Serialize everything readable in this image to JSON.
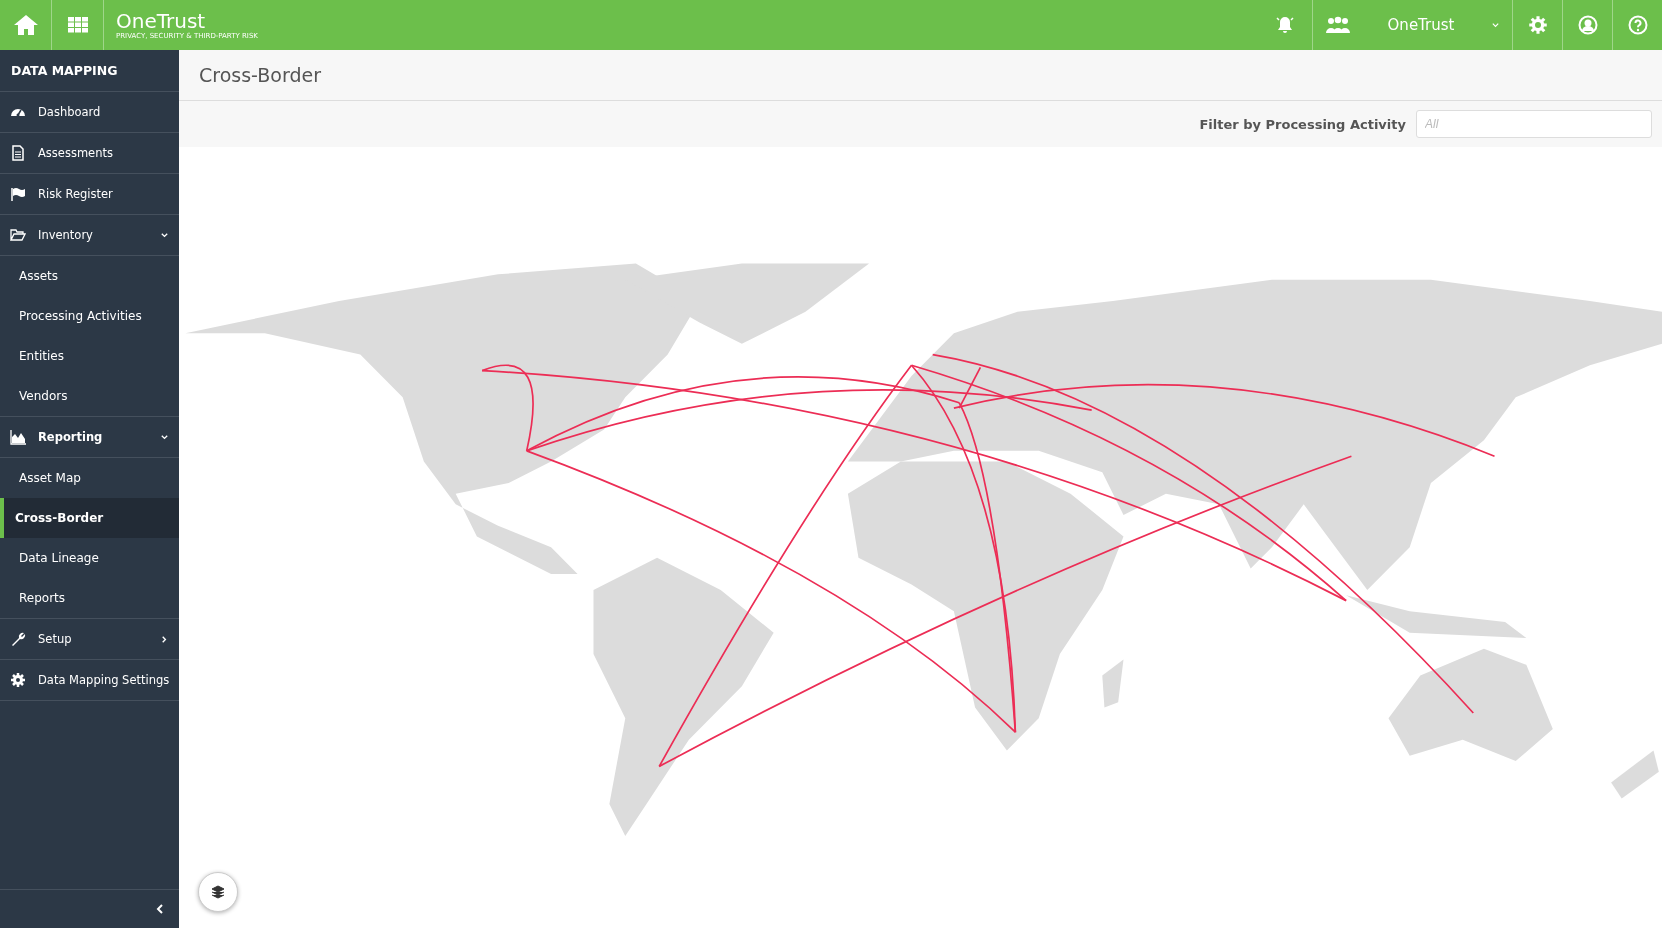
{
  "topbar": {
    "brand": "OneTrust",
    "tagline": "PRIVACY, SECURITY & THIRD-PARTY RISK",
    "org": "OneTrust"
  },
  "sidebar": {
    "title": "DATA MAPPING",
    "items": [
      {
        "label": "Dashboard",
        "selected": false
      },
      {
        "label": "Assessments",
        "selected": false
      },
      {
        "label": "Risk Register",
        "selected": false
      },
      {
        "label": "Inventory",
        "selected": false,
        "expanded": true,
        "children": [
          {
            "label": "Assets",
            "selected": false
          },
          {
            "label": "Processing Activities",
            "selected": false
          },
          {
            "label": "Entities",
            "selected": false
          },
          {
            "label": "Vendors",
            "selected": false
          }
        ]
      },
      {
        "label": "Reporting",
        "selected": false,
        "expanded": true,
        "children": [
          {
            "label": "Asset Map",
            "selected": false
          },
          {
            "label": "Cross-Border",
            "selected": true
          },
          {
            "label": "Data Lineage",
            "selected": false
          },
          {
            "label": "Reports",
            "selected": false
          }
        ]
      },
      {
        "label": "Setup",
        "selected": false,
        "expanded": false
      },
      {
        "label": "Data Mapping Settings",
        "selected": false
      }
    ]
  },
  "page": {
    "title": "Cross-Border"
  },
  "filter": {
    "label": "Filter by Processing Activity",
    "placeholder": "All"
  }
}
